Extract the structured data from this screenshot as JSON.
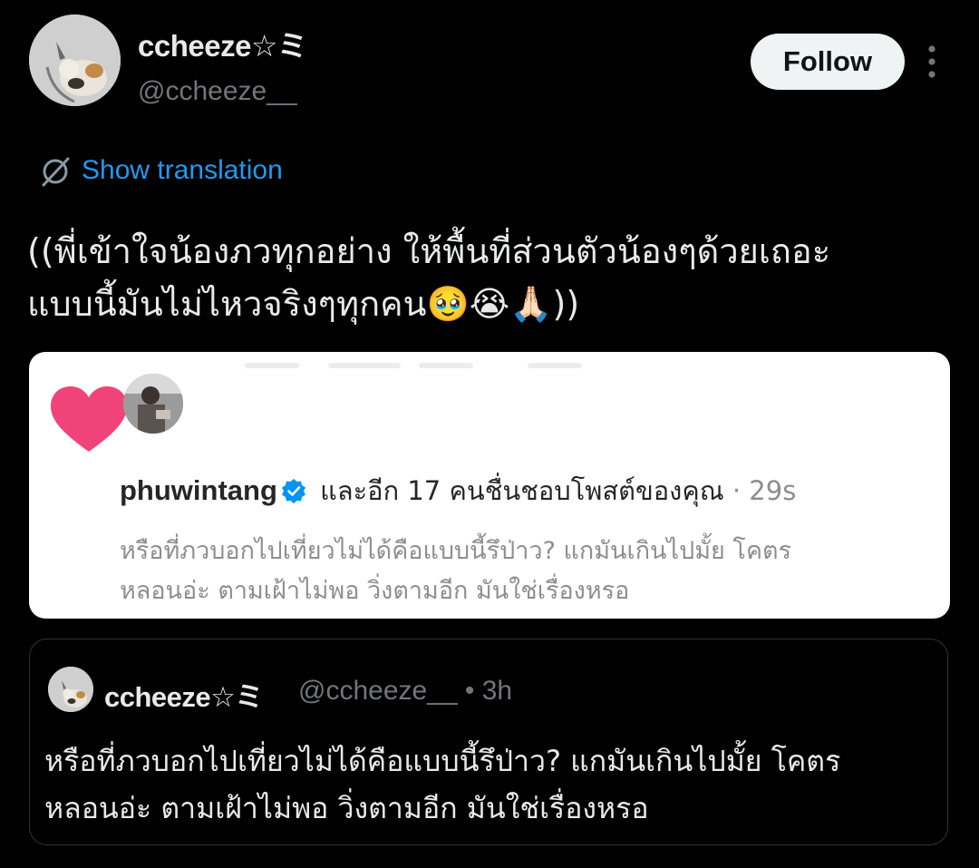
{
  "author": {
    "display_name": "ccheeze☆ミ",
    "handle": "@ccheeze__"
  },
  "follow_label": "Follow",
  "translation_label": "Show translation",
  "tweet": {
    "line1": "((พี่เข้าใจน้องภวทุกอย่าง ให้พื้นที่ส่วนตัวน้องๆด้วยเถอะ",
    "line2": "แบบนี้มันไม่ไหวจริงๆทุกคน🥹😭🙏🏻))"
  },
  "card": {
    "username": "phuwintang",
    "notification": "และอีก 17 คนชื่นชอบโพสต์ของคุณ",
    "time": "· 29s",
    "comment_line1": "หรือที่ภวบอกไปเที่ยวไม่ได้คือแบบนี้รึป่าว? แกมันเกินไปมั้ย โคตร",
    "comment_line2": "หลอนอ่ะ ตามเฝ้าไม่พอ วิ่งตามอีก มันใช่เรื่องหรอ"
  },
  "quote": {
    "display_name": "ccheeze☆ミ",
    "handle": "@ccheeze__",
    "time": "• 3h",
    "line1": "หรือที่ภวบอกไปเที่ยวไม่ได้คือแบบนี้รึป่าว? แกมันเกินไปมั้ย โคตร",
    "line2": "หลอนอ่ะ ตามเฝ้าไม่พอ วิ่งตามอีก มันใช่เรื่องหรอ"
  },
  "colors": {
    "background": "#000000",
    "link": "#1d9bf0",
    "heart": "#f0437a",
    "verified": "#0095f6"
  },
  "icons": [
    "translate-icon",
    "more-icon",
    "heart-icon",
    "verified-icon"
  ]
}
